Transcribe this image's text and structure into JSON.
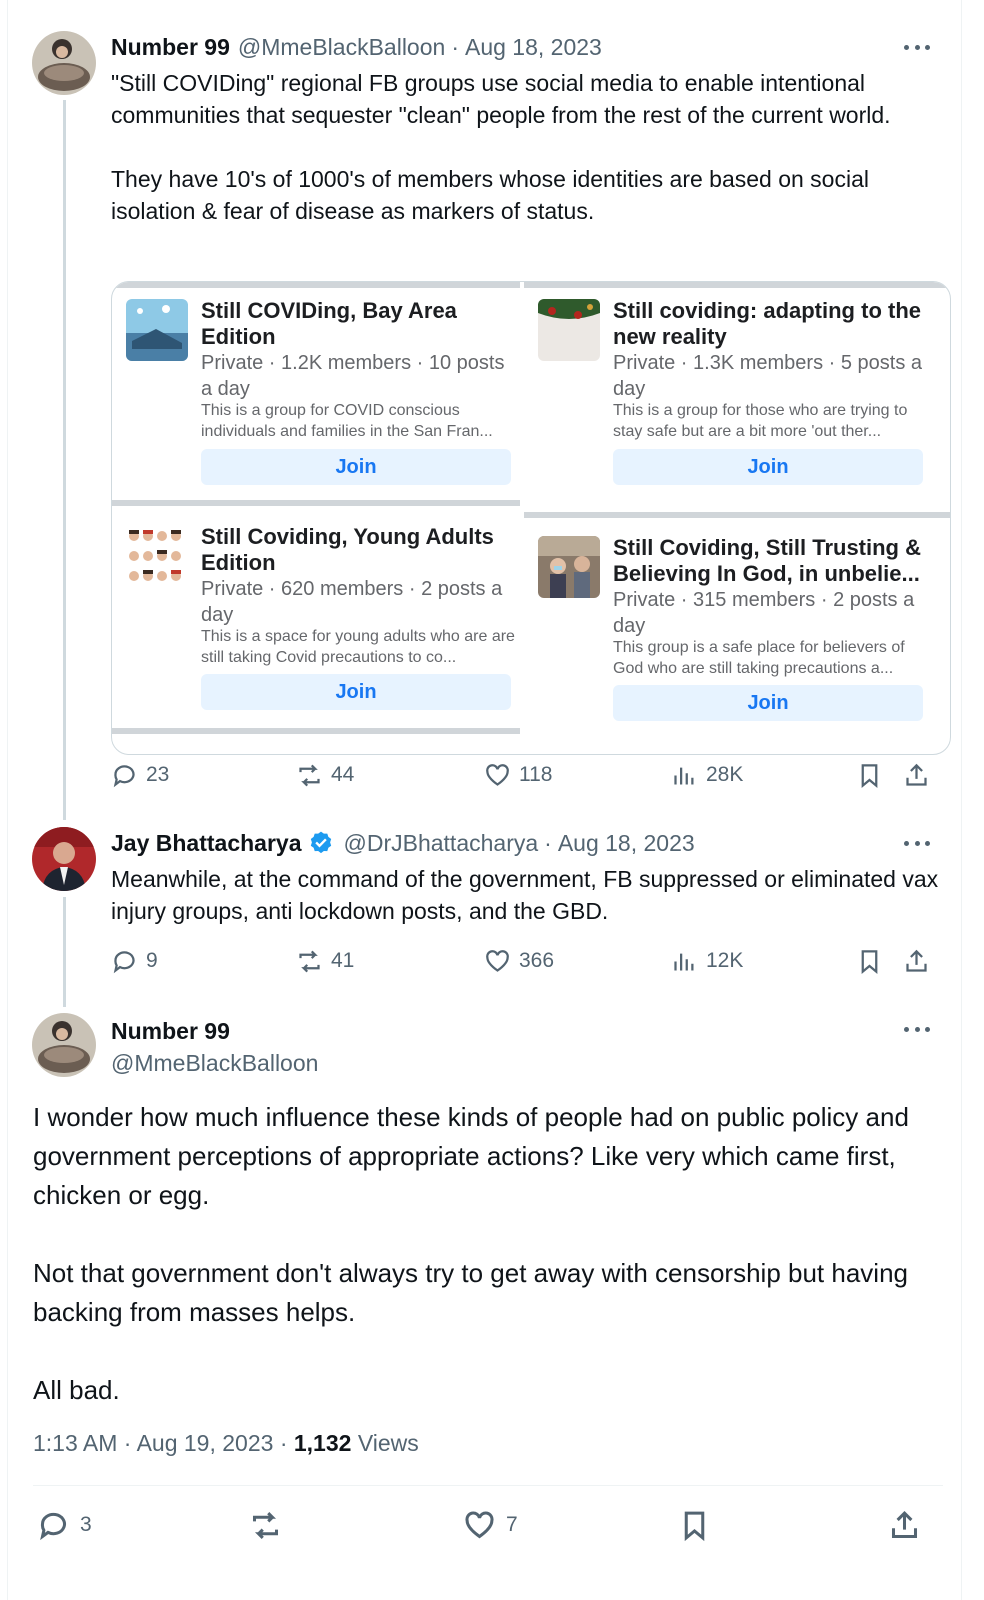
{
  "tweet1": {
    "name": "Number 99",
    "handle": "@MmeBlackBalloon",
    "separator": "·",
    "date": "Aug 18, 2023",
    "text": "\"Still COVIDing\" regional FB groups use social media to enable intentional communities that sequester \"clean\" people from the rest of the current world.\n\nThey have 10's of 1000's of members whose identities are based on social isolation & fear of disease as markers of status.",
    "groups": [
      {
        "title": "Still COVIDing, Bay Area Edition",
        "meta": "Private · 1.2K members · 10 posts a day",
        "desc": "This is a group for COVID conscious individuals and families in the San Fran...",
        "join": "Join"
      },
      {
        "title": "Still coviding: adapting to the new reality",
        "meta": "Private · 1.3K members · 5 posts a day",
        "desc": "This is a group for those who are trying to stay safe but are a bit more 'out ther...",
        "join": "Join"
      },
      {
        "title": "Still Coviding, Young Adults Edition",
        "meta": "Private · 620 members · 2 posts a day",
        "desc": "This is a space for young adults who are are still taking Covid precautions to co...",
        "join": "Join"
      },
      {
        "title": "Still Coviding, Still Trusting & Believing In God, in unbelie...",
        "meta": "Private · 315 members · 2 posts a day",
        "desc": "This group is a safe place for believers of God who are still taking precautions a...",
        "join": "Join"
      }
    ],
    "stats": {
      "replies": "23",
      "reposts": "44",
      "likes": "118",
      "views": "28K"
    }
  },
  "tweet2": {
    "name": "Jay Bhattacharya",
    "handle": "@DrJBhattacharya",
    "separator": "·",
    "date": "Aug 18, 2023",
    "text": "Meanwhile, at the command of the government, FB suppressed or eliminated vax injury groups, anti lockdown posts, and the GBD.",
    "stats": {
      "replies": "9",
      "reposts": "41",
      "likes": "366",
      "views": "12K"
    }
  },
  "main": {
    "name": "Number 99",
    "handle": "@MmeBlackBalloon",
    "text": "I wonder how much influence these kinds of people had on public policy and government perceptions of appropriate actions? Like very which came first, chicken or egg.\n\nNot that government don't always try to get away with censorship but having backing from masses helps.\n\nAll bad.",
    "time": "1:13 AM",
    "separator": "·",
    "date": "Aug 19, 2023",
    "views_count": "1,132",
    "views_label": "Views",
    "stats": {
      "replies": "3",
      "likes": "7"
    }
  },
  "colors": {
    "accent": "#1d9bf0",
    "join_bg": "#e7f3ff",
    "join_text": "#1877f2",
    "muted": "#536471"
  },
  "icons": [
    "reply-icon",
    "repost-icon",
    "like-icon",
    "views-icon",
    "bookmark-icon",
    "share-icon",
    "verified-badge-icon",
    "more-icon"
  ]
}
